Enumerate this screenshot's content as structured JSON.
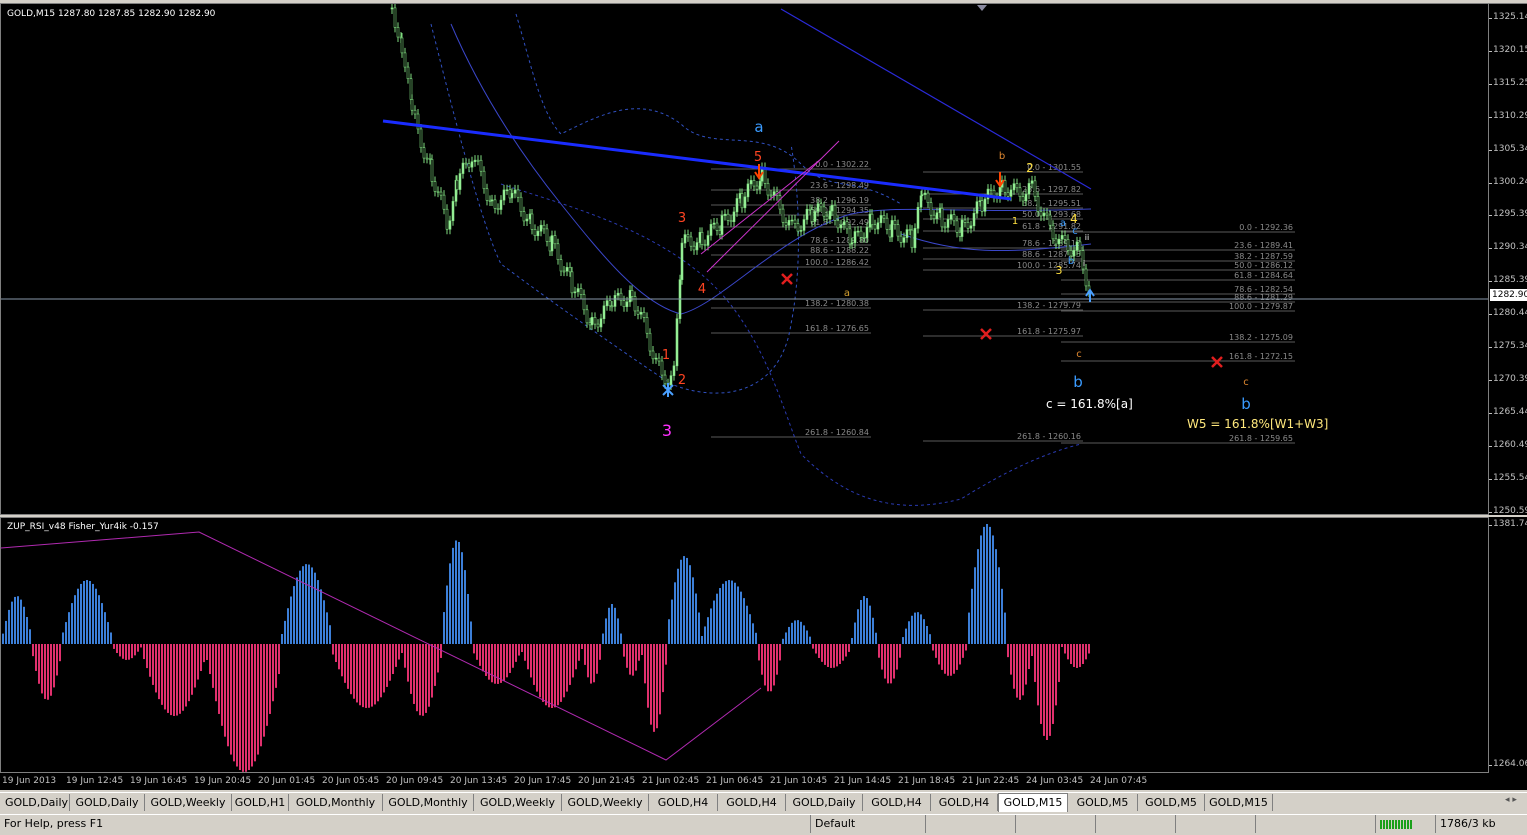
{
  "window": {
    "main_label": "GOLD,M15  1287.80 1287.85 1282.90 1282.90",
    "indicator_label": "ZUP_RSI_v48  Fisher_Yur4ik -0.157"
  },
  "price_axis": {
    "ticks": [
      "1325.14",
      "1320.15",
      "1315.25",
      "1310.29",
      "1305.34",
      "1300.24",
      "1295.39",
      "1290.34",
      "1285.39",
      "1280.44",
      "1275.34",
      "1270.39",
      "1265.44",
      "1260.49",
      "1255.54",
      "1250.59"
    ],
    "current": "1282.90"
  },
  "indicator_axis": {
    "top": "1381.74",
    "bottom": "1264.06"
  },
  "time_axis": {
    "labels": [
      "19 Jun 2013",
      "19 Jun 12:45",
      "19 Jun 16:45",
      "19 Jun 20:45",
      "20 Jun 01:45",
      "20 Jun 05:45",
      "20 Jun 09:45",
      "20 Jun 13:45",
      "20 Jun 17:45",
      "20 Jun 21:45",
      "21 Jun 02:45",
      "21 Jun 06:45",
      "21 Jun 10:45",
      "21 Jun 14:45",
      "21 Jun 18:45",
      "21 Jun 22:45",
      "24 Jun 03:45",
      "24 Jun 07:45"
    ]
  },
  "fib_levels": {
    "set1": [
      "0.0 - 1302.22",
      "23.6 - 1298.49",
      "38.2 - 1296.19",
      "50.0 - 1294.35",
      "61.8 - 1292.49",
      "78.6 - 1289.80",
      "88.6 - 1288.22",
      "100.0 - 1286.42",
      "138.2 - 1280.38",
      "161.8 - 1276.65",
      "261.8 - 1260.84"
    ],
    "set2": [
      "0.0 - 1301.55",
      "23.6 - 1297.82",
      "38.2 - 1295.51",
      "50.0 - 1293.68",
      "61.8 - 1291.82",
      "78.6 - 1289.13",
      "88.6 - 1287.55",
      "100.0 - 1285.74",
      "138.2 - 1279.79",
      "161.8 - 1275.97",
      "261.8 - 1260.16"
    ],
    "set3": [
      "0.0 - 1292.36",
      "23.6 - 1289.41",
      "38.2 - 1287.59",
      "50.0 - 1286.12",
      "61.8 - 1284.64",
      "78.6 - 1282.54",
      "88.6 - 1281.29",
      "100.0 - 1279.87",
      "138.2 - 1275.09",
      "161.8 - 1272.15",
      "261.8 - 1259.65"
    ]
  },
  "wave_labels": {
    "a_blue": "a",
    "five": "5",
    "three_red": "3",
    "four_red": "4",
    "one_red": "1",
    "two_red": "2",
    "three_magenta": "3",
    "a_small": "a",
    "b_orange": "b",
    "two_yellow": "2",
    "one_yellow": "1",
    "four_yellow": "4",
    "three_yellow": "3",
    "c_orange": "c",
    "c_orange2": "c",
    "b_blue1": "b",
    "b_blue2": "b",
    "ii_white": "ii",
    "a_blue_small": "a",
    "c_blue_small": "c",
    "b_blue_small": "b",
    "i_small": "i"
  },
  "annotations": {
    "c_target": "c = 161.8%[a]",
    "w5_target": "W5 = 161.8%[W1+W3]"
  },
  "tabs": [
    {
      "label": "GOLD,Daily"
    },
    {
      "label": "GOLD,Daily"
    },
    {
      "label": "GOLD,Weekly"
    },
    {
      "label": "GOLD,H1"
    },
    {
      "label": "GOLD,Monthly"
    },
    {
      "label": "GOLD,Monthly"
    },
    {
      "label": "GOLD,Weekly"
    },
    {
      "label": "GOLD,Weekly"
    },
    {
      "label": "GOLD,H4"
    },
    {
      "label": "GOLD,H4"
    },
    {
      "label": "GOLD,Daily"
    },
    {
      "label": "GOLD,H4"
    },
    {
      "label": "GOLD,H4"
    },
    {
      "label": "GOLD,M15",
      "active": true
    },
    {
      "label": "GOLD,M5"
    },
    {
      "label": "GOLD,M5"
    },
    {
      "label": "GOLD,M15"
    }
  ],
  "status": {
    "help": "For Help, press F1",
    "profile": "Default",
    "traffic": "1786/3 kb"
  },
  "colors": {
    "candle": "#90ee90",
    "hist_pos": "#3c7fd8",
    "hist_neg": "#e0306d",
    "trendline": "#0000ff",
    "fib": "#8a8a8a"
  }
}
